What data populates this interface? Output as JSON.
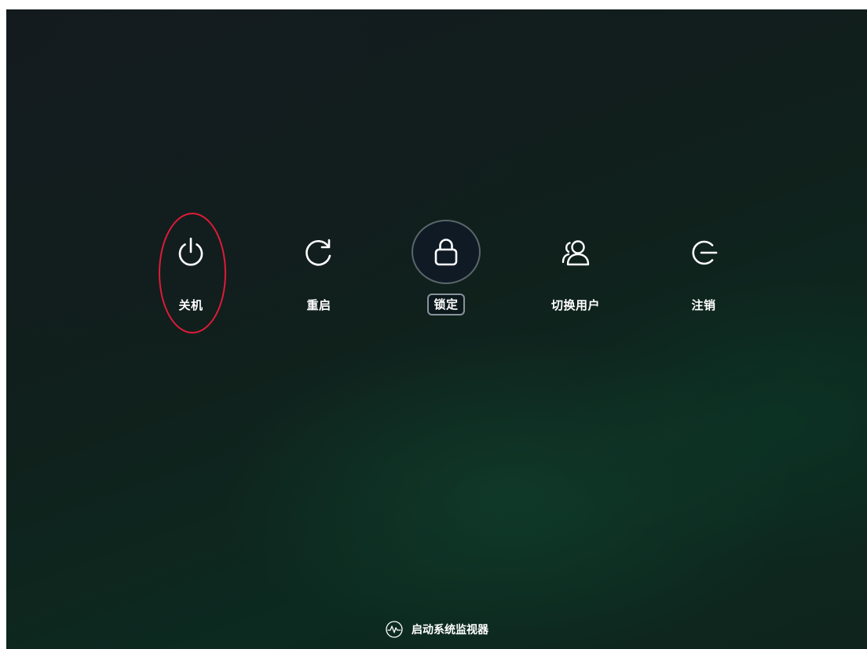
{
  "actions": [
    {
      "id": "shutdown",
      "label": "关机",
      "icon": "power-icon"
    },
    {
      "id": "reboot",
      "label": "重启",
      "icon": "restart-icon"
    },
    {
      "id": "lock",
      "label": "锁定",
      "icon": "lock-icon",
      "selected": true
    },
    {
      "id": "switch-user",
      "label": "切换用户",
      "icon": "users-icon"
    },
    {
      "id": "logout",
      "label": "注销",
      "icon": "logout-icon"
    }
  ],
  "footer": {
    "label": "启动系统监视器",
    "icon": "system-monitor-icon"
  },
  "colors": {
    "annotation": "#e11a38",
    "selected_bg": "#0f1a25",
    "text": "#ffffff"
  }
}
